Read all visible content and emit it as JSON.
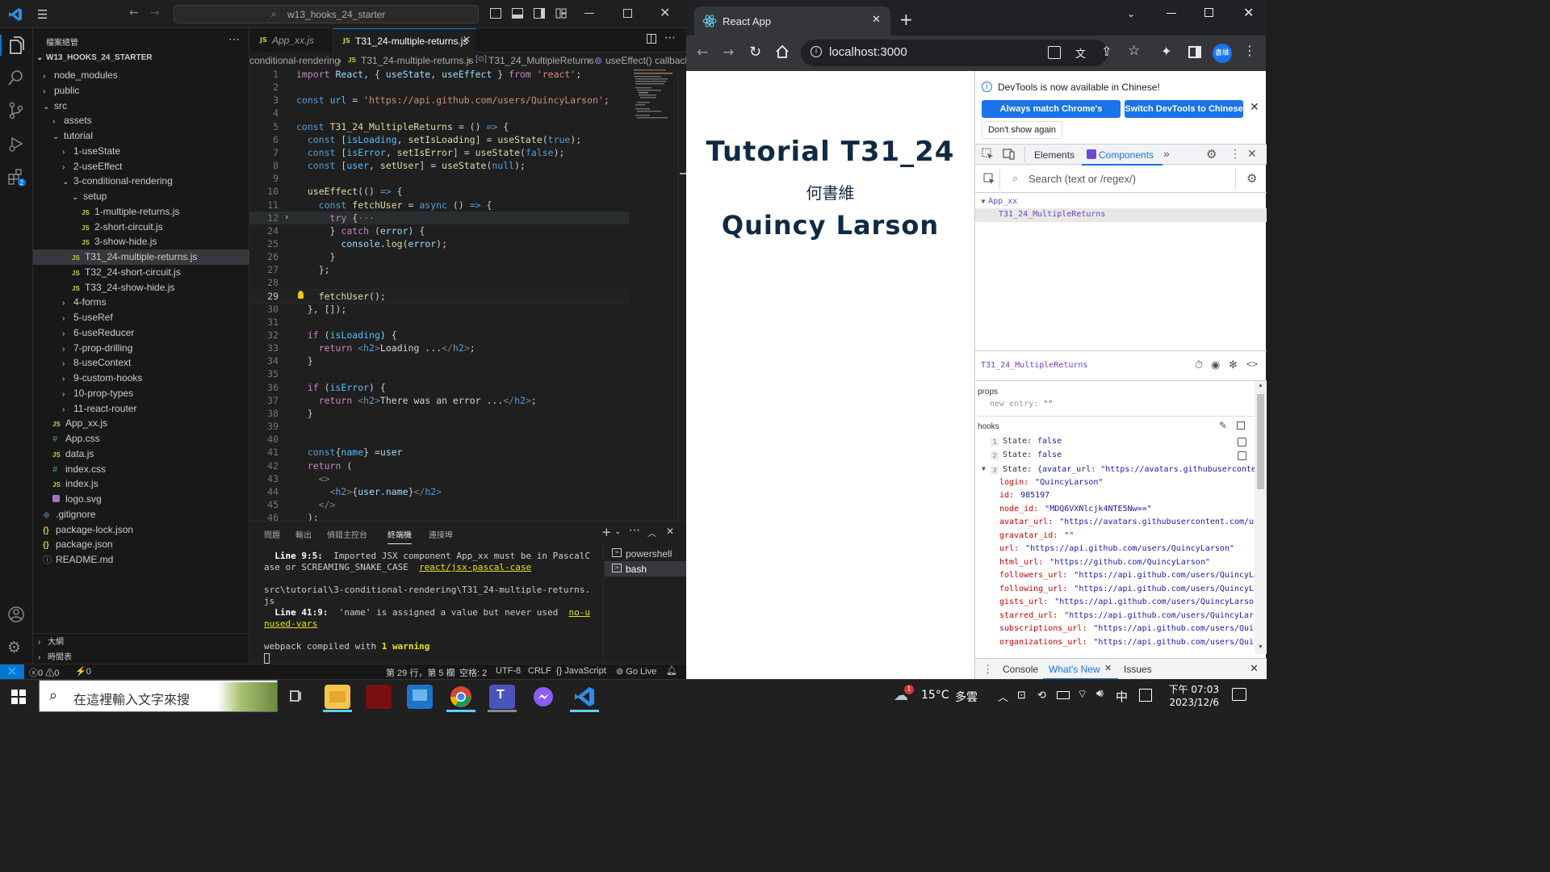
{
  "vscode": {
    "search_box": "w13_hooks_24_starter",
    "explorer_title": "檔案總管",
    "root": "W13_HOOKS_24_STARTER",
    "tree": [
      {
        "label": "node_modules",
        "depth": 1,
        "kind": "folder",
        "open": false
      },
      {
        "label": "public",
        "depth": 1,
        "kind": "folder",
        "open": false
      },
      {
        "label": "src",
        "depth": 1,
        "kind": "folder",
        "open": true
      },
      {
        "label": "assets",
        "depth": 2,
        "kind": "folder",
        "open": false
      },
      {
        "label": "tutorial",
        "depth": 2,
        "kind": "folder",
        "open": true
      },
      {
        "label": "1-useState",
        "depth": 3,
        "kind": "folder",
        "open": false
      },
      {
        "label": "2-useEffect",
        "depth": 3,
        "kind": "folder",
        "open": false
      },
      {
        "label": "3-conditional-rendering",
        "depth": 3,
        "kind": "folder",
        "open": true
      },
      {
        "label": "setup",
        "depth": 4,
        "kind": "folder",
        "open": true
      },
      {
        "label": "1-multiple-returns.js",
        "depth": 5,
        "kind": "js"
      },
      {
        "label": "2-short-circuit.js",
        "depth": 5,
        "kind": "js"
      },
      {
        "label": "3-show-hide.js",
        "depth": 5,
        "kind": "js"
      },
      {
        "label": "T31_24-multiple-returns.js",
        "depth": 4,
        "kind": "js",
        "selected": true
      },
      {
        "label": "T32_24-short-circuit.js",
        "depth": 4,
        "kind": "js"
      },
      {
        "label": "T33_24-show-hide.js",
        "depth": 4,
        "kind": "js"
      },
      {
        "label": "4-forms",
        "depth": 3,
        "kind": "folder",
        "open": false
      },
      {
        "label": "5-useRef",
        "depth": 3,
        "kind": "folder",
        "open": false
      },
      {
        "label": "6-useReducer",
        "depth": 3,
        "kind": "folder",
        "open": false
      },
      {
        "label": "7-prop-drilling",
        "depth": 3,
        "kind": "folder",
        "open": false
      },
      {
        "label": "8-useContext",
        "depth": 3,
        "kind": "folder",
        "open": false
      },
      {
        "label": "9-custom-hooks",
        "depth": 3,
        "kind": "folder",
        "open": false
      },
      {
        "label": "10-prop-types",
        "depth": 3,
        "kind": "folder",
        "open": false
      },
      {
        "label": "11-react-router",
        "depth": 3,
        "kind": "folder",
        "open": false
      },
      {
        "label": "App_xx.js",
        "depth": 2,
        "kind": "js"
      },
      {
        "label": "App.css",
        "depth": 2,
        "kind": "css"
      },
      {
        "label": "data.js",
        "depth": 2,
        "kind": "js"
      },
      {
        "label": "index.css",
        "depth": 2,
        "kind": "css"
      },
      {
        "label": "index.js",
        "depth": 2,
        "kind": "js"
      },
      {
        "label": "logo.svg",
        "depth": 2,
        "kind": "svg"
      },
      {
        "label": ".gitignore",
        "depth": 1,
        "kind": "git"
      },
      {
        "label": "package-lock.json",
        "depth": 1,
        "kind": "json"
      },
      {
        "label": "package.json",
        "depth": 1,
        "kind": "json"
      },
      {
        "label": "README.md",
        "depth": 1,
        "kind": "info"
      }
    ],
    "outline_label": "大綱",
    "timeline_label": "時間表",
    "tabs": [
      {
        "label": "App_xx.js",
        "active": false
      },
      {
        "label": "T31_24-multiple-returns.js",
        "active": true
      }
    ],
    "breadcrumb": [
      "conditional-rendering",
      "T31_24-multiple-returns.js",
      "T31_24_MultipleReturns",
      "useEffect() callback"
    ],
    "code": [
      {
        "n": "1",
        "t": [
          [
            "kw",
            "import"
          ],
          [
            "pun",
            " "
          ],
          [
            "var",
            "React"
          ],
          [
            "pun",
            ", { "
          ],
          [
            "var",
            "useState"
          ],
          [
            "pun",
            ", "
          ],
          [
            "var",
            "useEffect"
          ],
          [
            "pun",
            " } "
          ],
          [
            "kw",
            "from"
          ],
          [
            "pun",
            " "
          ],
          [
            "str",
            "'react'"
          ],
          [
            "pun",
            ";"
          ]
        ]
      },
      {
        "n": "2",
        "t": []
      },
      {
        "n": "3",
        "t": [
          [
            "kw2",
            "const"
          ],
          [
            "pun",
            " "
          ],
          [
            "con",
            "url"
          ],
          [
            "pun",
            " = "
          ],
          [
            "str",
            "'https://api.github.com/users/QuincyLarson'"
          ],
          [
            "pun",
            ";"
          ]
        ]
      },
      {
        "n": "4",
        "t": []
      },
      {
        "n": "5",
        "t": [
          [
            "kw2",
            "const"
          ],
          [
            "pun",
            " "
          ],
          [
            "fn",
            "T31_24_MultipleReturns"
          ],
          [
            "pun",
            " = () "
          ],
          [
            "kw2",
            "=>"
          ],
          [
            "pun",
            " {"
          ]
        ]
      },
      {
        "n": "6",
        "t": [
          [
            "pun",
            "  "
          ],
          [
            "kw2",
            "const"
          ],
          [
            "pun",
            " ["
          ],
          [
            "con",
            "isLoading"
          ],
          [
            "pun",
            ", "
          ],
          [
            "fn",
            "setIsLoading"
          ],
          [
            "pun",
            "] = "
          ],
          [
            "fn",
            "useState"
          ],
          [
            "pun",
            "("
          ],
          [
            "kw2",
            "true"
          ],
          [
            "pun",
            ");"
          ]
        ]
      },
      {
        "n": "7",
        "t": [
          [
            "pun",
            "  "
          ],
          [
            "kw2",
            "const"
          ],
          [
            "pun",
            " ["
          ],
          [
            "con",
            "isError"
          ],
          [
            "pun",
            ", "
          ],
          [
            "fn",
            "setIsError"
          ],
          [
            "pun",
            "] = "
          ],
          [
            "fn",
            "useState"
          ],
          [
            "pun",
            "("
          ],
          [
            "kw2",
            "false"
          ],
          [
            "pun",
            ");"
          ]
        ]
      },
      {
        "n": "8",
        "t": [
          [
            "pun",
            "  "
          ],
          [
            "kw2",
            "const"
          ],
          [
            "pun",
            " ["
          ],
          [
            "con",
            "user"
          ],
          [
            "pun",
            ", "
          ],
          [
            "fn",
            "setUser"
          ],
          [
            "pun",
            "] = "
          ],
          [
            "fn",
            "useState"
          ],
          [
            "pun",
            "("
          ],
          [
            "kw2",
            "null"
          ],
          [
            "pun",
            ");"
          ]
        ]
      },
      {
        "n": "9",
        "t": []
      },
      {
        "n": "10",
        "t": [
          [
            "pun",
            "  "
          ],
          [
            "fn",
            "useEffect"
          ],
          [
            "pun",
            "(() "
          ],
          [
            "kw2",
            "=>"
          ],
          [
            "pun",
            " {"
          ]
        ]
      },
      {
        "n": "11",
        "t": [
          [
            "pun",
            "    "
          ],
          [
            "kw2",
            "const"
          ],
          [
            "pun",
            " "
          ],
          [
            "fn",
            "fetchUser"
          ],
          [
            "pun",
            " = "
          ],
          [
            "kw2",
            "async"
          ],
          [
            "pun",
            " () "
          ],
          [
            "kw2",
            "=>"
          ],
          [
            "pun",
            " {"
          ]
        ]
      },
      {
        "n": "12",
        "t": [
          [
            "pun",
            "      "
          ],
          [
            "kw",
            "try"
          ],
          [
            "pun",
            " {"
          ],
          [
            "tag",
            "···"
          ]
        ]
      },
      {
        "n": "24",
        "t": [
          [
            "pun",
            "      } "
          ],
          [
            "kw",
            "catch"
          ],
          [
            "pun",
            " ("
          ],
          [
            "var",
            "error"
          ],
          [
            "pun",
            ") {"
          ]
        ]
      },
      {
        "n": "25",
        "t": [
          [
            "pun",
            "        "
          ],
          [
            "var",
            "console"
          ],
          [
            "pun",
            "."
          ],
          [
            "fn",
            "log"
          ],
          [
            "pun",
            "("
          ],
          [
            "var",
            "error"
          ],
          [
            "pun",
            ");"
          ]
        ]
      },
      {
        "n": "26",
        "t": [
          [
            "pun",
            "      }"
          ]
        ]
      },
      {
        "n": "27",
        "t": [
          [
            "pun",
            "    };"
          ]
        ]
      },
      {
        "n": "28",
        "t": []
      },
      {
        "n": "29",
        "t": [
          [
            "pun",
            "    "
          ],
          [
            "fn",
            "fetchUser"
          ],
          [
            "pun",
            "();"
          ]
        ]
      },
      {
        "n": "30",
        "t": [
          [
            "pun",
            "  }, []);"
          ]
        ]
      },
      {
        "n": "31",
        "t": []
      },
      {
        "n": "32",
        "t": [
          [
            "pun",
            "  "
          ],
          [
            "kw",
            "if"
          ],
          [
            "pun",
            " ("
          ],
          [
            "con",
            "isLoading"
          ],
          [
            "pun",
            ") {"
          ]
        ]
      },
      {
        "n": "33",
        "t": [
          [
            "pun",
            "    "
          ],
          [
            "kw",
            "return"
          ],
          [
            "pun",
            " "
          ],
          [
            "tag",
            "<"
          ],
          [
            "tg",
            "h2"
          ],
          [
            "tag",
            ">"
          ],
          [
            "txt",
            "Loading ..."
          ],
          [
            "tag",
            "</"
          ],
          [
            "tg",
            "h2"
          ],
          [
            "tag",
            ">"
          ],
          [
            "pun",
            ";"
          ]
        ]
      },
      {
        "n": "34",
        "t": [
          [
            "pun",
            "  }"
          ]
        ]
      },
      {
        "n": "35",
        "t": []
      },
      {
        "n": "36",
        "t": [
          [
            "pun",
            "  "
          ],
          [
            "kw",
            "if"
          ],
          [
            "pun",
            " ("
          ],
          [
            "con",
            "isError"
          ],
          [
            "pun",
            ") {"
          ]
        ]
      },
      {
        "n": "37",
        "t": [
          [
            "pun",
            "    "
          ],
          [
            "kw",
            "return"
          ],
          [
            "pun",
            " "
          ],
          [
            "tag",
            "<"
          ],
          [
            "tg",
            "h2"
          ],
          [
            "tag",
            ">"
          ],
          [
            "txt",
            "There was an error ..."
          ],
          [
            "tag",
            "</"
          ],
          [
            "tg",
            "h2"
          ],
          [
            "tag",
            ">"
          ],
          [
            "pun",
            ";"
          ]
        ]
      },
      {
        "n": "38",
        "t": [
          [
            "pun",
            "  }"
          ]
        ]
      },
      {
        "n": "39",
        "t": []
      },
      {
        "n": "40",
        "t": []
      },
      {
        "n": "41",
        "t": [
          [
            "pun",
            "  "
          ],
          [
            "kw2",
            "const"
          ],
          [
            "pun",
            "{"
          ],
          [
            "con",
            "name"
          ],
          [
            "pun",
            "} ="
          ],
          [
            "var",
            "user"
          ]
        ]
      },
      {
        "n": "42",
        "t": [
          [
            "pun",
            "  "
          ],
          [
            "kw",
            "return"
          ],
          [
            "pun",
            " ("
          ]
        ]
      },
      {
        "n": "43",
        "t": [
          [
            "pun",
            "    "
          ],
          [
            "tag",
            "<>"
          ]
        ]
      },
      {
        "n": "44",
        "t": [
          [
            "pun",
            "      "
          ],
          [
            "tag",
            "<"
          ],
          [
            "tg",
            "h2"
          ],
          [
            "tag",
            ">"
          ],
          [
            "pun",
            "{"
          ],
          [
            "var",
            "user"
          ],
          [
            "pun",
            "."
          ],
          [
            "var",
            "name"
          ],
          [
            "pun",
            "}"
          ],
          [
            "tag",
            "</"
          ],
          [
            "tg",
            "h2"
          ],
          [
            "tag",
            ">"
          ]
        ]
      },
      {
        "n": "45",
        "t": [
          [
            "pun",
            "    "
          ],
          [
            "tag",
            "</>"
          ]
        ]
      },
      {
        "n": "46",
        "t": [
          [
            "pun",
            "  );"
          ]
        ]
      }
    ],
    "current_line": "29",
    "panel_tabs": [
      "問題",
      "輸出",
      "偵錯主控台",
      "終端機",
      "連接埠"
    ],
    "panel_active": "終端機",
    "terminal": {
      "l1_bold": "Line 9:5:",
      "l1_text": "  Imported JSX component App_xx must be in PascalC",
      "l2_text": "ase or SCREAMING_SNAKE_CASE  ",
      "l2_link": "react/jsx-pascal-case",
      "l3": "src\\tutorial\\3-conditional-rendering\\T31_24-multiple-returns.",
      "l4": "js",
      "l5_bold": "Line 41:9:",
      "l5_text": "  'name' is assigned a value but never used  ",
      "l5_link": "no-u",
      "l6_link": "nused-vars",
      "l7_pre": "webpack compiled with ",
      "l7_warn": "1 warning"
    },
    "shells": [
      "powershell",
      "bash"
    ],
    "status": {
      "errors": "0",
      "warnings": "0",
      "ports": "0",
      "position": "第 29 行，第 5 欄",
      "spaces": "空格: 2",
      "encoding": "UTF-8",
      "eol": "CRLF",
      "language": "JavaScript",
      "golive": "Go Live"
    }
  },
  "chrome": {
    "tab_title": "React App",
    "url": "localhost:3000",
    "profile_label": "書維",
    "page": {
      "h1": "Tutorial T31_24",
      "author": "何書維",
      "name": "Quincy Larson"
    },
    "devtools": {
      "notice": "DevTools is now available in Chinese!",
      "btn_match": "Always match Chrome's language",
      "btn_switch": "Switch DevTools to Chinese",
      "btn_dont": "Don't show again",
      "tab_elements": "Elements",
      "tab_components": "Components",
      "search_placeholder": "Search (text or /regex/)",
      "tree_root": "App_xx",
      "tree_child": "T31_24_MultipleReturns",
      "selected_component": "T31_24_MultipleReturns",
      "props_label": "props",
      "props_key": "new entry:",
      "props_val": "\"\"",
      "hooks_label": "hooks",
      "hooks": [
        {
          "idx": "1",
          "key": "State:",
          "val": "false"
        },
        {
          "idx": "2",
          "key": "State:",
          "val": "false"
        },
        {
          "idx": "3",
          "key": "State:",
          "val": "{avatar_url: \"https://avatars.githubuserconten…"
        }
      ],
      "fields": [
        {
          "k": "login:",
          "v": "\"QuincyLarson\""
        },
        {
          "k": "id:",
          "v": "985197"
        },
        {
          "k": "node_id:",
          "v": "\"MDQ6VXNlcjk4NTE5Nw==\""
        },
        {
          "k": "avatar_url:",
          "v": "\"https://avatars.githubusercontent.com/u/98"
        },
        {
          "k": "gravatar_id:",
          "v": "\"\""
        },
        {
          "k": "url:",
          "v": "\"https://api.github.com/users/QuincyLarson\""
        },
        {
          "k": "html_url:",
          "v": "\"https://github.com/QuincyLarson\""
        },
        {
          "k": "followers_url:",
          "v": "\"https://api.github.com/users/QuincyLars"
        },
        {
          "k": "following_url:",
          "v": "\"https://api.github.com/users/QuincyLars"
        },
        {
          "k": "gists_url:",
          "v": "\"https://api.github.com/users/QuincyLarson/g"
        },
        {
          "k": "starred_url:",
          "v": "\"https://api.github.com/users/QuincyLarson"
        },
        {
          "k": "subscriptions_url:",
          "v": "\"https://api.github.com/users/Quincy"
        },
        {
          "k": "organizations_url:",
          "v": "\"https://api.github.com/users/Quincy"
        }
      ],
      "drawer_console": "Console",
      "drawer_whatsnew": "What's New",
      "drawer_issues": "Issues"
    }
  },
  "taskbar": {
    "search_placeholder": "在這裡輸入文字來搜",
    "weather_temp": "15°C",
    "weather_desc": "多雲",
    "ime": "中",
    "time_ampm": "下午 07:03",
    "date": "2023/12/6"
  }
}
